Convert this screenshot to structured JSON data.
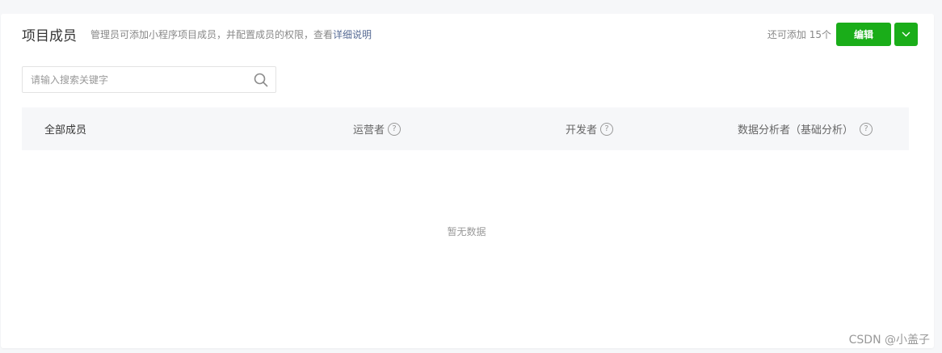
{
  "header": {
    "title": "项目成员",
    "description": "管理员可添加小程序项目成员，并配置成员的权限，查看",
    "description_link": "详细说明"
  },
  "actions": {
    "quota": "还可添加 15个",
    "edit_label": "编辑"
  },
  "search": {
    "placeholder": "请输入搜索关键字"
  },
  "table": {
    "columns": [
      {
        "label": "全部成员"
      },
      {
        "label": "运营者"
      },
      {
        "label": "开发者"
      },
      {
        "label": "数据分析者（基础分析）"
      }
    ],
    "help_glyph": "?"
  },
  "empty_text": "暂无数据",
  "watermark": "CSDN @小盖子",
  "colors": {
    "primary": "#1aad19",
    "link": "#576b95"
  }
}
